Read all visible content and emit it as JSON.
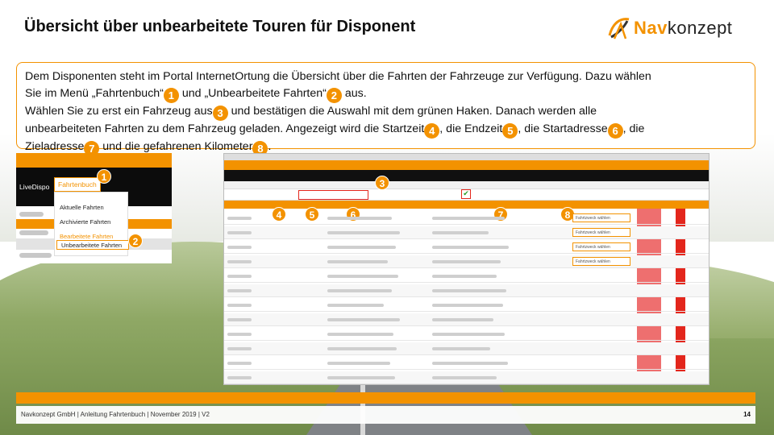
{
  "slide": {
    "title": "Übersicht über unbearbeitete Touren für Disponent",
    "logo": {
      "text_accent": "Nav",
      "text_rest": "konzept"
    },
    "paragraph": {
      "l1a": "Dem Disponenten steht im Portal InternetOrtung die Übersicht über die Fahrten der Fahrzeuge zur Verfügung. Dazu wählen",
      "l2a": "Sie im Menü „Fahrtenbuch“",
      "l2b": " und „Unbearbeitete Fahrten“",
      "l2c": " aus.",
      "l3a": "Wählen Sie zu erst ein Fahrzeug aus",
      "l3b": " und bestätigen die Auswahl mit dem grünen Haken. Danach werden alle",
      "l4a": "unbearbeiteten Fahrten zu dem Fahrzeug geladen. Angezeigt wird die Startzeit",
      "l4b": ", die Endzeit",
      "l4c": ", die Startadresse",
      "l4d": ", die",
      "l5a": "Zieladresse",
      "l5b": " und die gefahrenen Kilometer",
      "l5c": "."
    },
    "badges": [
      "1",
      "2",
      "3",
      "4",
      "5",
      "6",
      "7",
      "8"
    ]
  },
  "menu": {
    "live": "LiveDispo",
    "fahrtenbuch": "Fahrtenbuch",
    "items": [
      "Aktuelle Fahrten",
      "Archivierte Fahrten",
      "Bearbeitete Fahrten",
      "Unbearbeitete Fahrten"
    ]
  },
  "app": {
    "select_options": [
      "Fahrtzweck wählen",
      "Fahrtzweck wählen",
      "Fahrtzweck wählen",
      "Fahrtzweck wählen"
    ]
  },
  "footer": {
    "text": "Navkonzept GmbH  |  Anleitung Fahrtenbuch  |  November 2019  |  V2",
    "page": "14"
  },
  "colors": {
    "accent": "#f39200",
    "highlight": "#e3261c",
    "check": "#2a9d2a"
  }
}
